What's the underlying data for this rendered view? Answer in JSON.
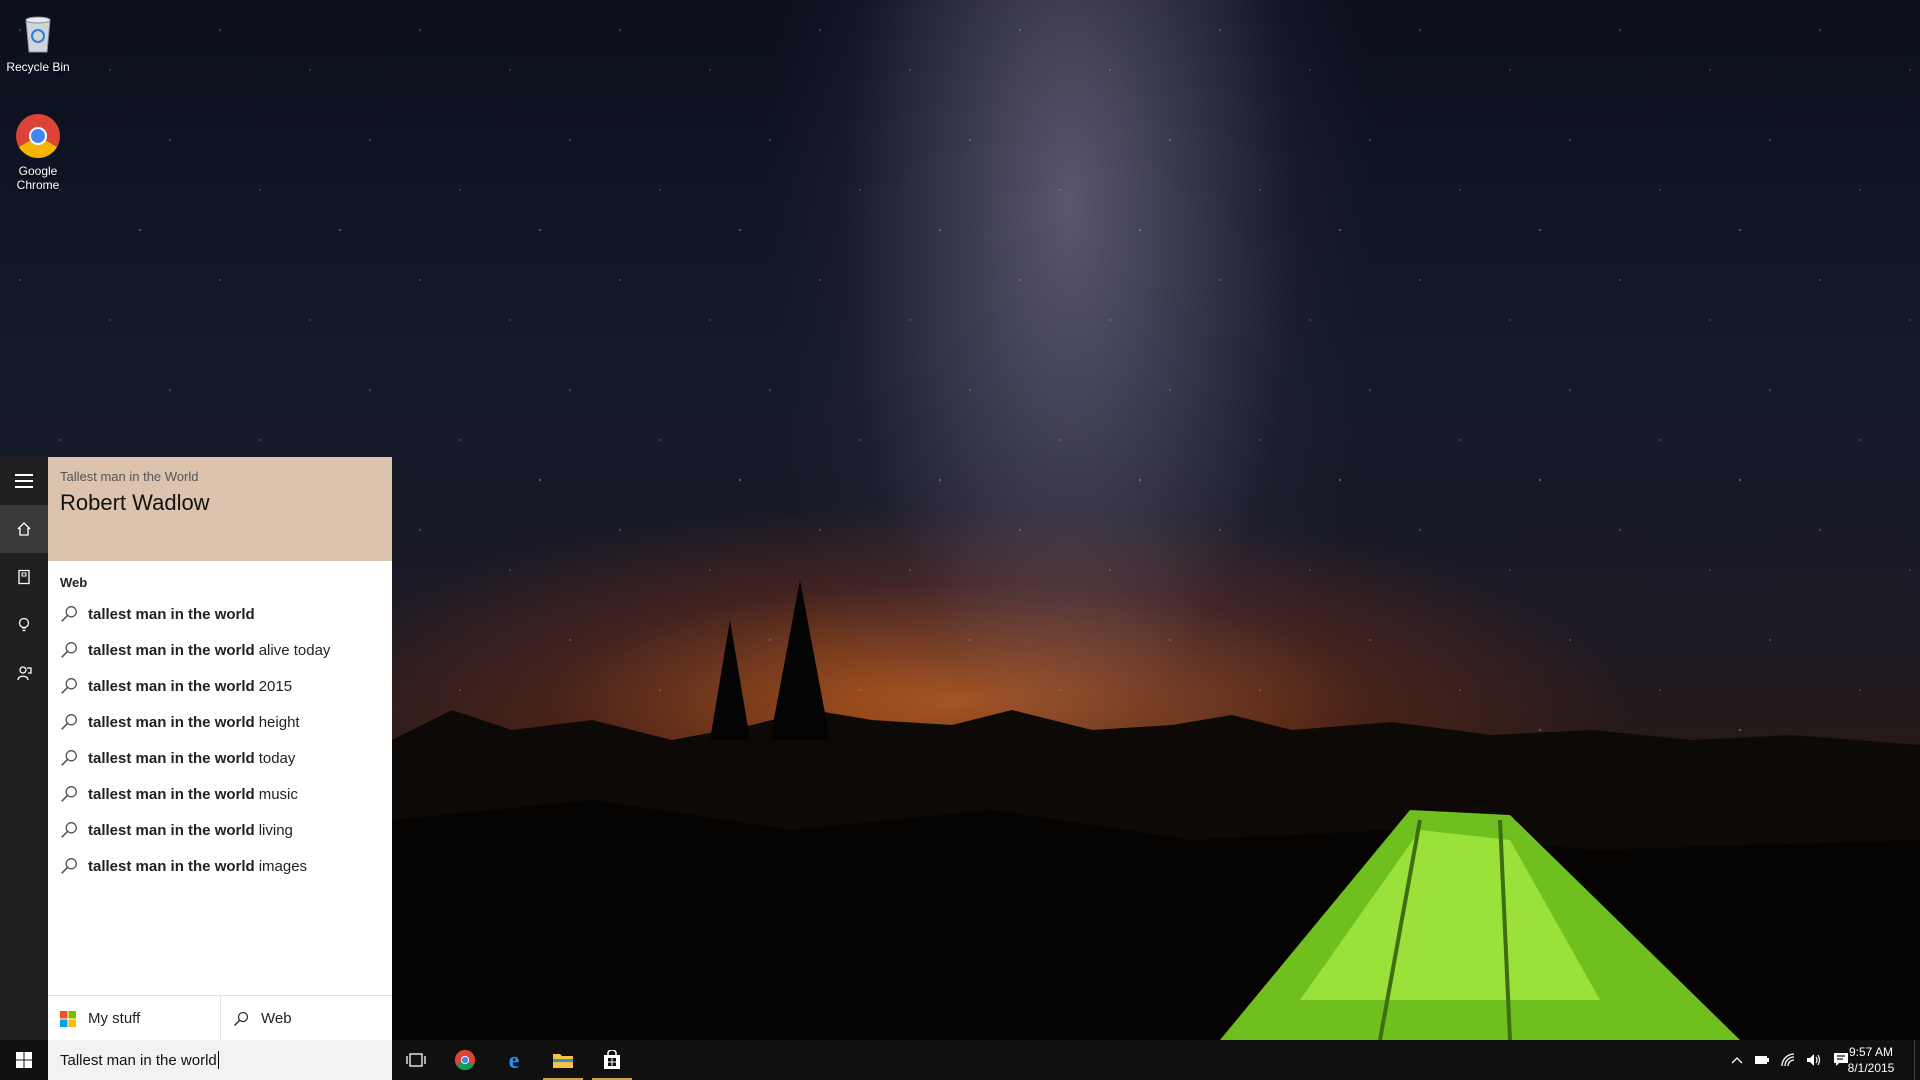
{
  "desktop": {
    "icons": [
      {
        "label": "Recycle Bin",
        "icon": "recycle-bin-icon"
      },
      {
        "label": "Google Chrome",
        "icon": "chrome-icon"
      }
    ]
  },
  "cortana": {
    "rail": [
      {
        "icon": "hamburger-menu-icon"
      },
      {
        "icon": "home-icon"
      },
      {
        "icon": "notebook-icon"
      },
      {
        "icon": "reminders-icon"
      },
      {
        "icon": "feedback-icon"
      }
    ],
    "answer": {
      "caption": "Tallest man in the World",
      "title": "Robert Wadlow"
    },
    "section_label": "Web",
    "suggestions": [
      {
        "bold": "tallest man in the world",
        "rest": ""
      },
      {
        "bold": "tallest man in the world",
        "rest": "alive today"
      },
      {
        "bold": "tallest man in the world",
        "rest": "2015"
      },
      {
        "bold": "tallest man in the world",
        "rest": "height"
      },
      {
        "bold": "tallest man in the world",
        "rest": "today"
      },
      {
        "bold": "tallest man in the world",
        "rest": "music"
      },
      {
        "bold": "tallest man in the world",
        "rest": "living"
      },
      {
        "bold": "tallest man in the world",
        "rest": "images"
      }
    ],
    "scopes": {
      "my_stuff": "My stuff",
      "web": "Web"
    },
    "accent": "#dcc3ad"
  },
  "taskbar": {
    "search_value": "Tallest man in the world",
    "apps": [
      {
        "icon": "task-view-icon"
      },
      {
        "icon": "chrome-icon"
      },
      {
        "icon": "edge-icon"
      },
      {
        "icon": "file-explorer-icon"
      },
      {
        "icon": "store-icon"
      }
    ],
    "tray": [
      {
        "icon": "chevron-up-icon"
      },
      {
        "icon": "battery-icon"
      },
      {
        "icon": "wifi-icon"
      },
      {
        "icon": "volume-icon"
      },
      {
        "icon": "action-center-icon"
      }
    ],
    "time": "9:57 AM",
    "date": "8/1/2015"
  }
}
